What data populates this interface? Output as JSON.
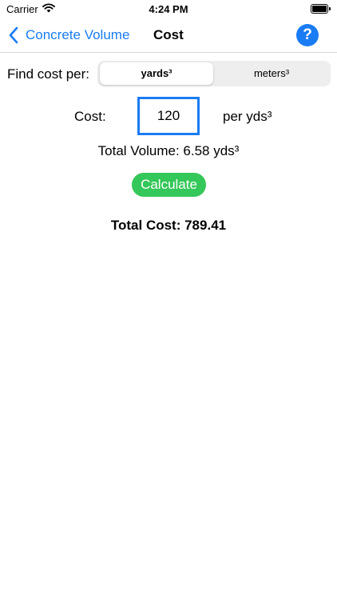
{
  "status_bar": {
    "carrier": "Carrier",
    "time": "4:24 PM"
  },
  "nav": {
    "back_label": "Concrete Volume",
    "title": "Cost",
    "help_label": "?"
  },
  "form": {
    "find_label": "Find cost per:",
    "segments": [
      {
        "label": "yards³",
        "selected": true
      },
      {
        "label": "meters³",
        "selected": false
      }
    ],
    "cost_label": "Cost:",
    "cost_value": "120",
    "per_unit": "per yds³",
    "total_volume": "Total Volume: 6.58 yds³",
    "calculate_label": "Calculate",
    "total_cost": "Total Cost: 789.41"
  },
  "colors": {
    "accent": "#1a7cf4",
    "button_green": "#34c759"
  },
  "icons": {
    "wifi": "wifi-icon",
    "battery": "battery-icon",
    "back": "chevron-left-icon"
  }
}
